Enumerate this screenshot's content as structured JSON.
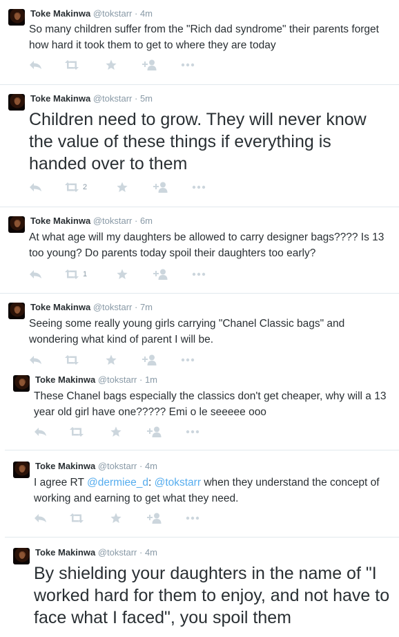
{
  "tweets": [
    {
      "name": "Toke Makinwa",
      "handle": "@tokstarr",
      "separator": "·",
      "time": "4m",
      "text": "So many children suffer from the \"Rich dad syndrome\" their parents forget how hard it took them to get to where they are today",
      "retweets": ""
    },
    {
      "name": "Toke Makinwa",
      "handle": "@tokstarr",
      "separator": "·",
      "time": "5m",
      "text": "Children need to grow. They will never know the value of these things if everything is handed over to them",
      "retweets": "2"
    },
    {
      "name": "Toke Makinwa",
      "handle": "@tokstarr",
      "separator": "·",
      "time": "6m",
      "text": "At what age will my daughters be allowed to carry designer bags???? Is 13 too young? Do parents today spoil their daughters too early?",
      "retweets": "1"
    },
    {
      "name": "Toke Makinwa",
      "handle": "@tokstarr",
      "separator": "·",
      "time": "7m",
      "text": "Seeing some really young girls carrying \"Chanel Classic bags\" and wondering what kind of parent I will be.",
      "retweets": ""
    },
    {
      "name": "Toke Makinwa",
      "handle": "@tokstarr",
      "separator": "·",
      "time": "1m",
      "text": "These Chanel bags especially the classics don't get cheaper, why will a 13 year old girl have one?????  Emi o le seeeee ooo",
      "retweets": ""
    },
    {
      "name": "Toke Makinwa",
      "handle": "@tokstarr",
      "separator": "·",
      "time": "4m",
      "text_parts": {
        "prefix": "I agree RT ",
        "mention1": "@dermiee_d",
        "middle": ": ",
        "mention2": "@tokstarr",
        "suffix": " when they understand the concept of working and earning to get what they need."
      },
      "retweets": ""
    },
    {
      "name": "Toke Makinwa",
      "handle": "@tokstarr",
      "separator": "·",
      "time": "4m",
      "text": "By shielding your daughters in the name of \"I worked hard for them to enjoy, and not have to face what I faced\", you spoil them",
      "retweets": ""
    }
  ],
  "icons": [
    "reply-icon",
    "retweet-icon",
    "favorite-icon",
    "follow-icon",
    "more-icon"
  ],
  "colors": {
    "text": "#292f33",
    "meta": "#8899a6",
    "link": "#55acee",
    "action_icon": "#ccd6dd",
    "separator": "#e1e8ed"
  }
}
